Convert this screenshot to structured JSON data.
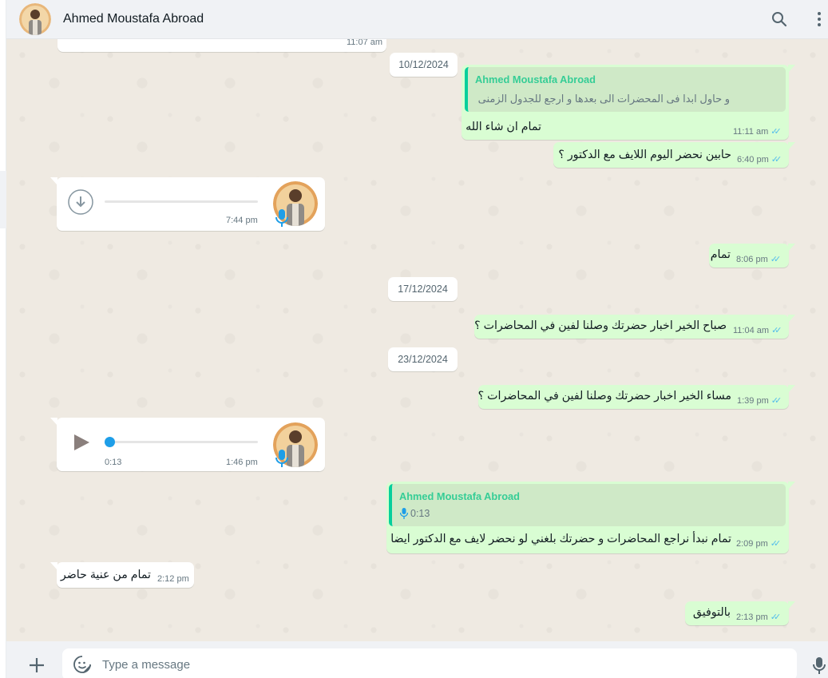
{
  "header": {
    "contact_name": "Ahmed Moustafa Abroad",
    "icons": [
      "avatar",
      "search-icon",
      "menu-icon"
    ]
  },
  "chat": {
    "partial_top": {
      "time": "11:07 am"
    },
    "dates": [
      "10/12/2024",
      "17/12/2024",
      "23/12/2024"
    ],
    "messages": [
      {
        "direction": "out",
        "quoted_name": "Ahmed Moustafa Abroad",
        "quoted_text": "و حاول ابدا فى المحضرات الى بعدها و ارجع للجدول الزمنى",
        "text": "تمام ان شاء الله",
        "time": "11:11 am",
        "status": "read"
      },
      {
        "direction": "out",
        "text": "حابين نحضر اليوم اللايف مع الدكتور ؟",
        "time": "6:40 pm",
        "status": "read"
      },
      {
        "direction": "in",
        "type": "voice",
        "state": "download",
        "time": "7:44 pm"
      },
      {
        "direction": "out",
        "text": "تمام",
        "time": "8:06 pm",
        "status": "read"
      },
      {
        "direction": "out",
        "text": "صباح الخير اخبار حضرتك وصلنا لفين في المحاضرات ؟",
        "time": "11:04 am",
        "status": "read"
      },
      {
        "direction": "out",
        "text": "مساء الخير اخبار حضرتك وصلنا لفين في المحاضرات ؟",
        "time": "1:39 pm",
        "status": "read"
      },
      {
        "direction": "in",
        "type": "voice",
        "state": "play",
        "duration": "0:13",
        "time": "1:46 pm"
      },
      {
        "direction": "out",
        "quoted_name": "Ahmed Moustafa Abroad",
        "quoted_text": "0:13",
        "text": "تمام نبدأ نراجع المحاضرات و حضرتك بلغني لو نحضر لايف مع الدكتور ايضا",
        "time": "2:09 pm",
        "status": "read"
      },
      {
        "direction": "in",
        "text": "تمام من عنية حاضر",
        "time": "2:12 pm"
      },
      {
        "direction": "out",
        "text": "بالتوفيق",
        "time": "2:13 pm",
        "status": "read"
      }
    ]
  },
  "composer": {
    "placeholder": "Type a message",
    "icons": [
      "plus-icon",
      "sticker-icon",
      "mic-icon"
    ]
  },
  "colors": {
    "outgoing_bubble": "#d9fdd3",
    "incoming_bubble": "#ffffff",
    "chat_background": "#efeae2",
    "read_ticks": "#53bdeb",
    "quote_name": "#35cd96",
    "voice_accent": "#1e9ee8"
  }
}
